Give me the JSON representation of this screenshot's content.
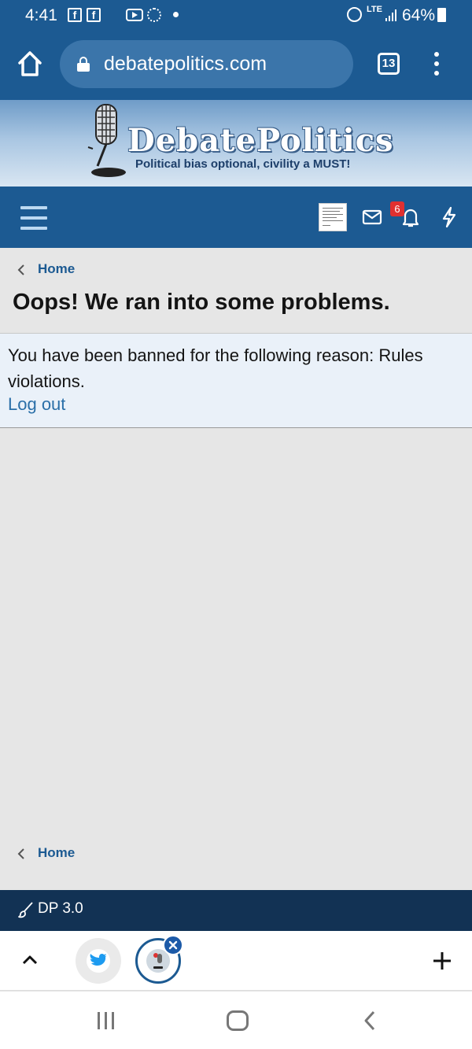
{
  "status_bar": {
    "time": "4:41",
    "fb_icon_1": "f",
    "fb_icon_2": "f",
    "network": "LTE",
    "battery": "64%"
  },
  "browser": {
    "url": "debatepolitics.com",
    "tab_count": "13"
  },
  "banner": {
    "title": "DebatePolitics",
    "tagline": "Political bias optional, civility a MUST!"
  },
  "navbar": {
    "alerts_badge": "6"
  },
  "breadcrumb": {
    "top_label": "Home",
    "bottom_label": "Home"
  },
  "page": {
    "title": "Oops! We ran into some problems.",
    "error_message": "You have been banned for the following reason: Rules violations.",
    "logout_label": "Log out"
  },
  "footer": {
    "style_label": "DP 3.0"
  },
  "colors": {
    "header_blue": "#1c5a92",
    "footer_navy": "#123254",
    "link_blue": "#2a6fa8",
    "badge_red": "#e03030"
  }
}
